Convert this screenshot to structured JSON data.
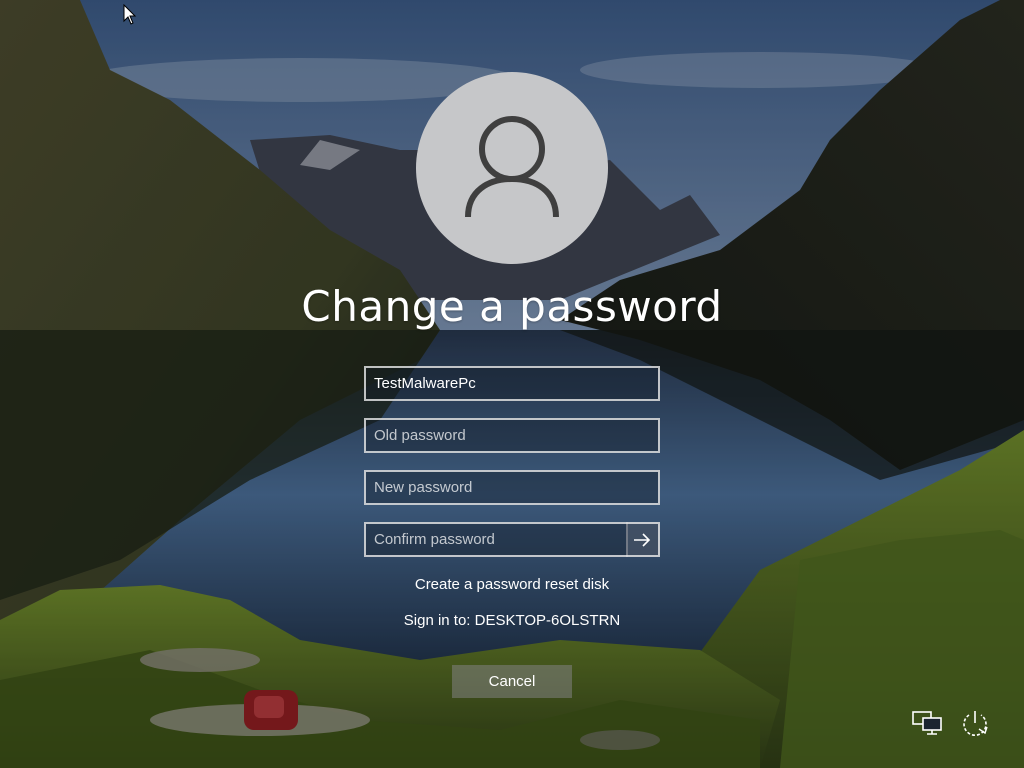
{
  "screen": {
    "title": "Change a password"
  },
  "form": {
    "username_value": "TestMalwarePc",
    "old_password_placeholder": "Old password",
    "new_password_placeholder": "New password",
    "confirm_password_placeholder": "Confirm password",
    "submit_icon": "arrow-right-icon"
  },
  "links": {
    "reset_disk": "Create a password reset disk",
    "sign_in_to": "Sign in to: DESKTOP-6OLSTRN"
  },
  "buttons": {
    "cancel": "Cancel"
  },
  "tray": {
    "icons": [
      "network-icon",
      "power-icon"
    ]
  },
  "colors": {
    "avatar_bg": "#c6c7c9",
    "text": "#ffffff"
  }
}
